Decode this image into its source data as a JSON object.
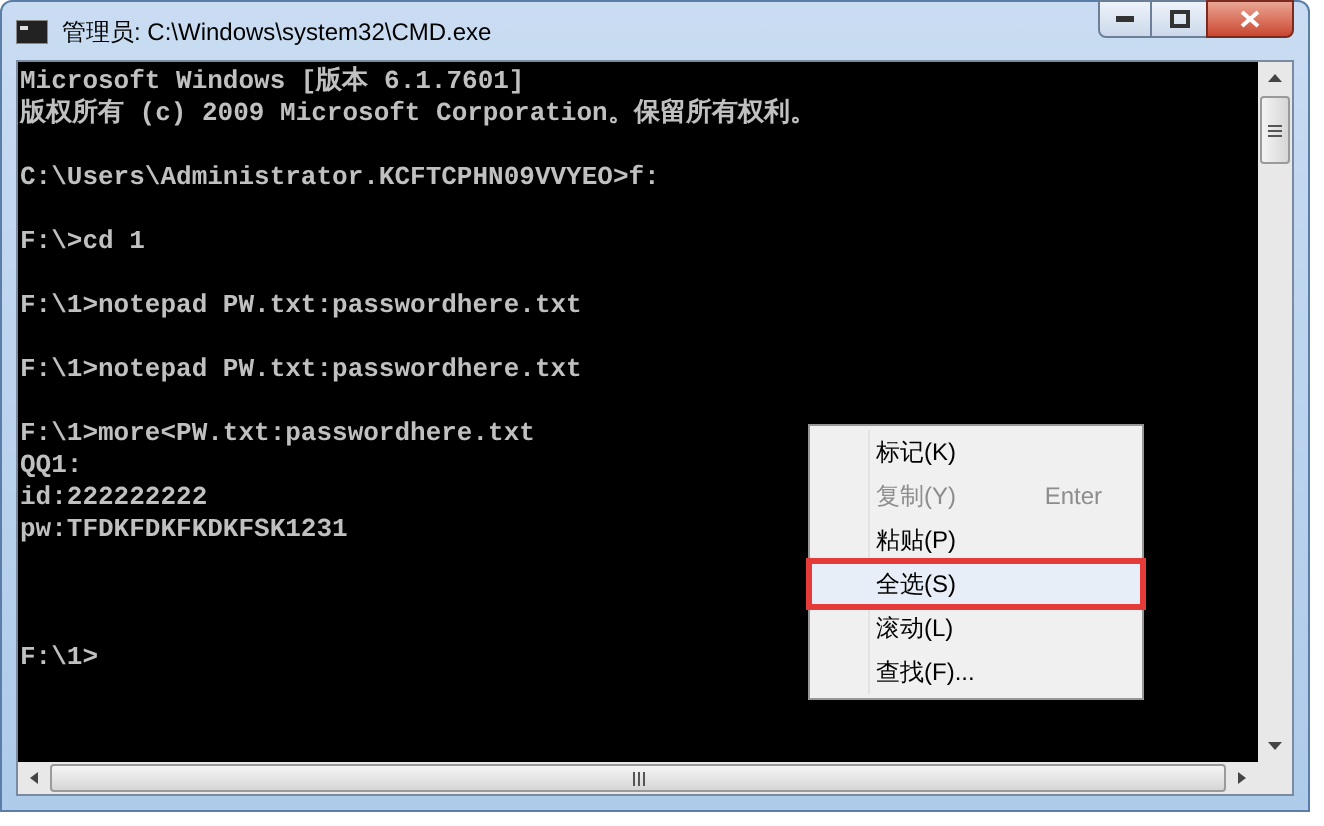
{
  "window": {
    "title": "管理员: C:\\Windows\\system32\\CMD.exe"
  },
  "console": {
    "blocks": [
      [
        "Microsoft Windows [版本 6.1.7601]",
        "版权所有 (c) 2009 Microsoft Corporation。保留所有权利。"
      ],
      [
        "C:\\Users\\Administrator.KCFTCPHN09VVYEO>f:"
      ],
      [
        "F:\\>cd 1"
      ],
      [
        "F:\\1>notepad PW.txt:passwordhere.txt"
      ],
      [
        "F:\\1>notepad PW.txt:passwordhere.txt"
      ],
      [
        "F:\\1>more<PW.txt:passwordhere.txt",
        "QQ1:",
        "id:222222222",
        "pw:TFDKFDKFKDKFSK1231"
      ]
    ],
    "prompt": "F:\\1>"
  },
  "context_menu": {
    "items": [
      {
        "label": "标记(K)",
        "disabled": false,
        "selected": false
      },
      {
        "label": "复制(Y)",
        "shortcut": "Enter",
        "disabled": true,
        "selected": false
      },
      {
        "label": "粘贴(P)",
        "disabled": false,
        "selected": false
      },
      {
        "label": "全选(S)",
        "disabled": false,
        "selected": true
      },
      {
        "label": "滚动(L)",
        "disabled": false,
        "selected": false
      },
      {
        "label": "查找(F)...",
        "disabled": false,
        "selected": false
      }
    ]
  }
}
